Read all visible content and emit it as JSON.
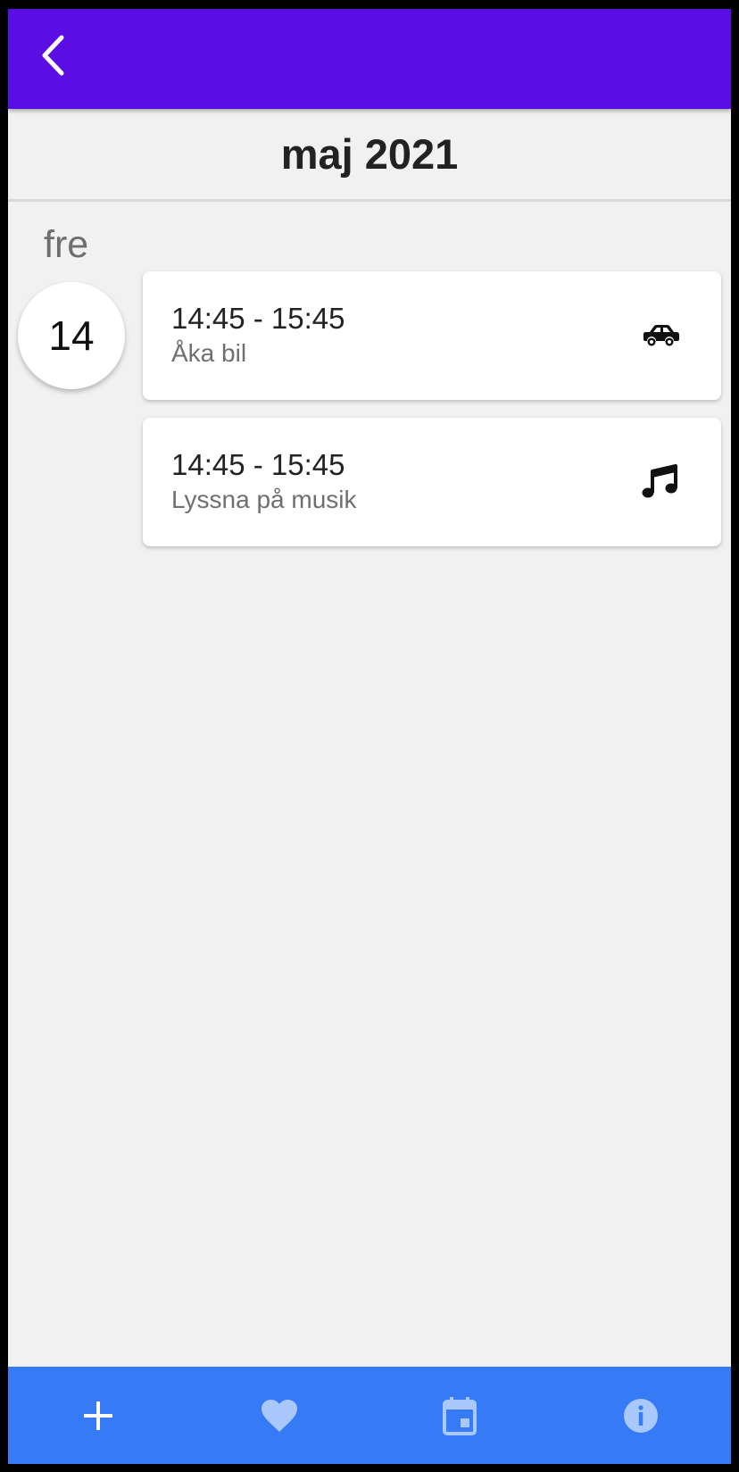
{
  "appbar": {
    "back_icon": "chevron-left-icon",
    "color": "#5a0ee4"
  },
  "calendar": {
    "month_title": "maj 2021",
    "weekday": "fre",
    "day_number": "14"
  },
  "activities": [
    {
      "time": "14:45 - 15:45",
      "title": "Åka bil",
      "icon": "car-icon"
    },
    {
      "time": "14:45 - 15:45",
      "title": "Lyssna på musik",
      "icon": "music-note-icon"
    }
  ],
  "bottom_nav": {
    "color": "#367af5",
    "items": [
      {
        "icon": "add-icon"
      },
      {
        "icon": "heart-icon"
      },
      {
        "icon": "calendar-icon"
      },
      {
        "icon": "info-icon"
      }
    ]
  }
}
